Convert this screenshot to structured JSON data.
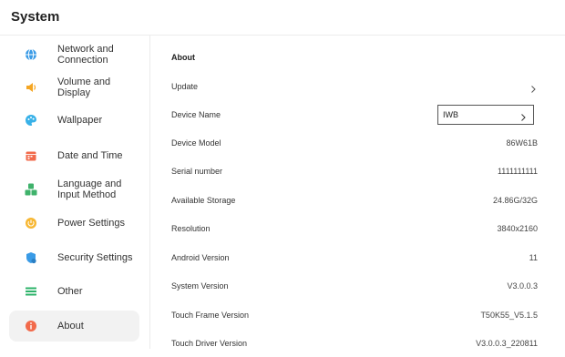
{
  "app": {
    "title": "System"
  },
  "sidebar": {
    "items": [
      {
        "label": "Network and\nConnection",
        "icon": "globe-icon",
        "color": "#3a9be6"
      },
      {
        "label": "Volume and\nDisplay",
        "icon": "speaker-icon",
        "color": "#f5a623"
      },
      {
        "label": "Wallpaper",
        "icon": "palette-icon",
        "color": "#38b1e8"
      },
      {
        "label": "Date and Time",
        "icon": "calendar-icon",
        "color": "#f26a4b"
      },
      {
        "label": "Language and\nInput Method",
        "icon": "grid-icon",
        "color": "#3fb26b"
      },
      {
        "label": "Power Settings",
        "icon": "power-icon",
        "color": "#f7b733"
      },
      {
        "label": "Security Settings",
        "icon": "shield-icon",
        "color": "#3a9be6"
      },
      {
        "label": "Other",
        "icon": "list-icon",
        "color": "#2db36a"
      },
      {
        "label": "About",
        "icon": "info-icon",
        "color": "#f26a4b"
      }
    ],
    "active_index": 8
  },
  "about": {
    "section_title": "About",
    "rows": [
      {
        "label": "Update",
        "value": "",
        "type": "chevron"
      },
      {
        "label": "Device Name",
        "value": "IWB",
        "type": "input"
      },
      {
        "label": "Device Model",
        "value": "86W61B",
        "type": "text"
      },
      {
        "label": "Serial number",
        "value": "1111111111",
        "type": "text"
      },
      {
        "label": "Available Storage",
        "value": "24.86G/32G",
        "type": "text"
      },
      {
        "label": "Resolution",
        "value": "3840x2160",
        "type": "text"
      },
      {
        "label": "Android Version",
        "value": "11",
        "type": "text"
      },
      {
        "label": "System Version",
        "value": "V3.0.0.3",
        "type": "text"
      },
      {
        "label": "Touch Frame Version",
        "value": "T50K55_V5.1.5",
        "type": "text"
      },
      {
        "label": "Touch Driver Version",
        "value": "V3.0.0.3_220811",
        "type": "text"
      }
    ]
  }
}
